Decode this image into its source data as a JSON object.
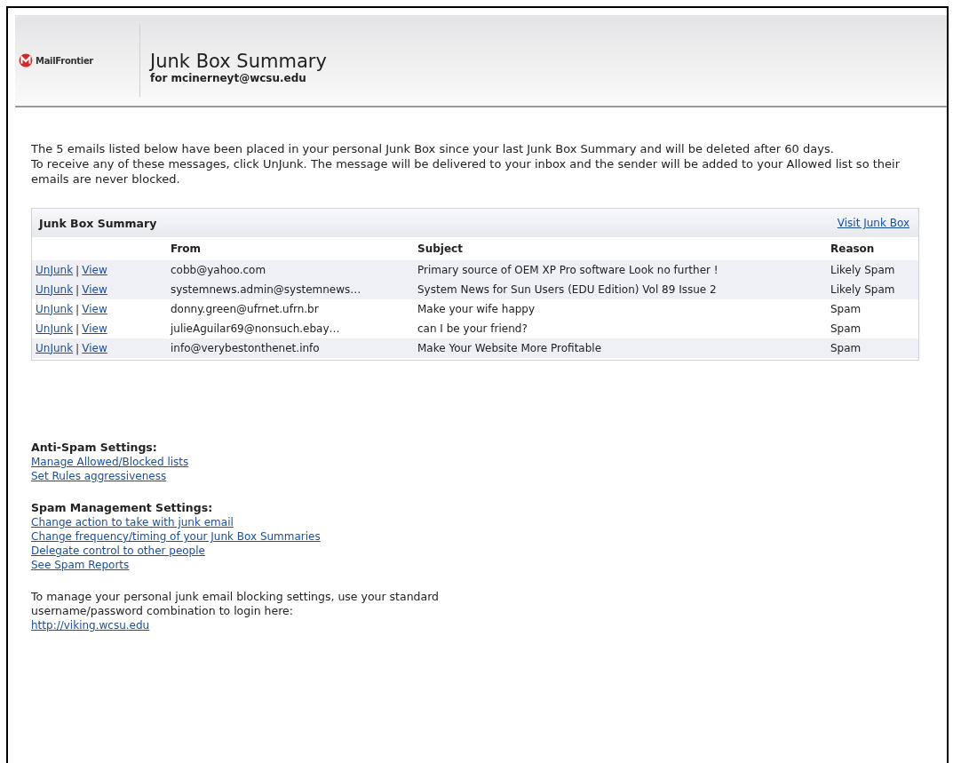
{
  "header": {
    "logo_text": "MailFrontier",
    "title": "Junk Box Summary",
    "subtitle": "for mcinerneyt@wcsu.edu"
  },
  "intro": [
    "The 5 emails listed below have been placed in your personal Junk Box since your last Junk Box Summary and will be deleted after 60 days.",
    "To receive any of these messages, click UnJunk. The message will be delivered to your inbox and the sender will be added to your Allowed list so their emails are never blocked."
  ],
  "table": {
    "title": "Junk Box Summary",
    "link": "Visit Junk Box",
    "columns": [
      "From",
      "Subject",
      "Reason"
    ],
    "rows": [
      {
        "unjunk": "UnJunk",
        "separator": "|",
        "view": "View",
        "from": "cobb@yahoo.com",
        "subject": "Primary source of OEM XP Pro software Look no further !",
        "reason": "Likely Spam",
        "shaded": true
      },
      {
        "unjunk": "UnJunk",
        "separator": "|",
        "view": "View",
        "from": "systemnews.admin@systemnews…",
        "subject": "System News for Sun Users (EDU Edition) Vol 89 Issue 2",
        "reason": "Likely Spam",
        "shaded": true
      },
      {
        "unjunk": "UnJunk",
        "separator": "|",
        "view": "View",
        "from": "donny.green@ufrnet.ufrn.br",
        "subject": "Make your wife happy",
        "reason": "Spam",
        "shaded": false
      },
      {
        "unjunk": "UnJunk",
        "separator": "|",
        "view": "View",
        "from": "julieAguilar69@nonsuch.ebay…",
        "subject": "can I be your friend?",
        "reason": "Spam",
        "shaded": false
      },
      {
        "unjunk": "UnJunk",
        "separator": "|",
        "view": "View",
        "from": "info@verybestonthenet.info",
        "subject": "Make Your Website More Profitable",
        "reason": "Spam",
        "shaded": true
      }
    ]
  },
  "settings": [
    {
      "heading": "Anti-Spam Settings:",
      "links": [
        "Manage Allowed/Blocked lists",
        "Set Rules aggressiveness"
      ]
    },
    {
      "heading": "Spam Management Settings:",
      "links": [
        "Change action to take with junk email",
        "Change frequency/timing of your Junk Box Summaries",
        "Delegate control to other people",
        "See Spam Reports"
      ]
    }
  ],
  "footer": {
    "text": "To manage your personal junk email blocking settings, use your standard username/password combination to login here:",
    "link": "http://viking.wcsu.edu"
  }
}
